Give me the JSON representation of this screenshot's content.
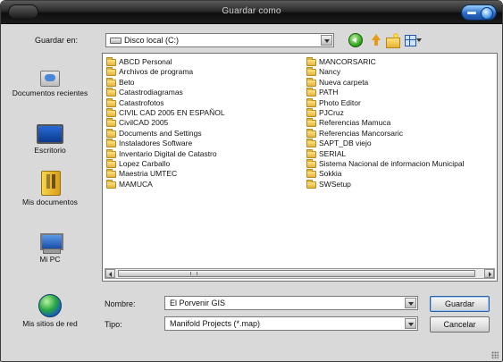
{
  "window": {
    "title": "Guardar como"
  },
  "toolbar": {
    "save_in_label": "Guardar en:",
    "save_in_value": "Disco local (C:)",
    "icons": [
      "back-icon",
      "up-folder-icon",
      "new-folder-icon",
      "views-menu-icon"
    ]
  },
  "places": [
    {
      "label": "Documentos recientes",
      "icon": "recent-documents-icon"
    },
    {
      "label": "Escritorio",
      "icon": "desktop-icon"
    },
    {
      "label": "Mis documentos",
      "icon": "my-documents-icon"
    },
    {
      "label": "Mi PC",
      "icon": "my-computer-icon"
    },
    {
      "label": "Mis sitios de red",
      "icon": "network-places-icon"
    }
  ],
  "files": {
    "column1": [
      "ABCD Personal",
      "Archivos de programa",
      "Beto",
      "Catastrodiagramas",
      "Catastrofotos",
      "CIVIL CAD 2005 EN ESPAÑOL",
      "CivilCAD 2005",
      "Documents and Settings",
      "Instaladores Software",
      "Inventario Digital de Catastro",
      "Lopez Carballo",
      "Maestria UMTEC",
      "MAMUCA"
    ],
    "column2": [
      "MANCORSARIC",
      "Nancy",
      "Nueva carpeta",
      "PATH",
      "Photo Editor",
      "PJCruz",
      "Referencias Mamuca",
      "Referencias Mancorsaric",
      "SAPT_DB viejo",
      "SERIAL",
      "Sistema Nacional de informacion Municipal",
      "Sokkia",
      "SWSetup"
    ]
  },
  "form": {
    "name_label": "Nombre:",
    "name_value": "El Porvenir GIS",
    "type_label": "Tipo:",
    "type_value": "Manifold Projects (*.map)"
  },
  "buttons": {
    "save": "Guardar",
    "cancel": "Cancelar"
  }
}
